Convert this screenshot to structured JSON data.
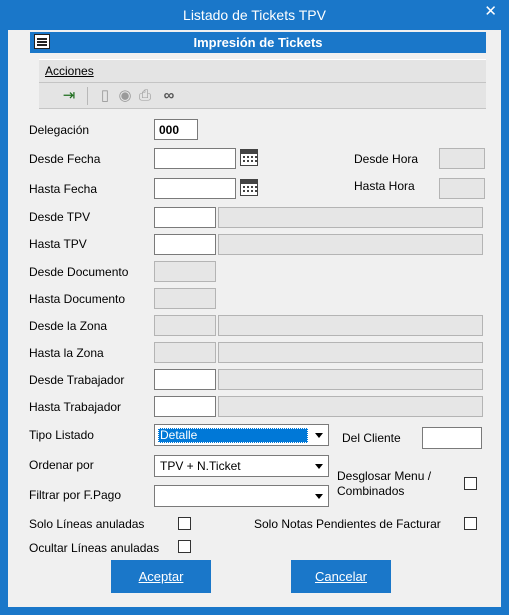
{
  "window": {
    "title": "Listado de Tickets TPV",
    "close_glyph": "✕"
  },
  "header": {
    "title": "Impresión de Tickets",
    "icon": "print-form-icon"
  },
  "menu": {
    "acciones": "Acciones"
  },
  "toolbar": {
    "buttons": [
      {
        "icon": "exit-door-icon",
        "glyph": "⇥"
      },
      {
        "icon": "page-icon",
        "glyph": "▯"
      },
      {
        "icon": "preview-icon",
        "glyph": "◉"
      },
      {
        "icon": "print-icon",
        "glyph": "⎙"
      },
      {
        "icon": "binoculars-icon",
        "glyph": "∞"
      }
    ]
  },
  "form": {
    "delegacion": {
      "label": "Delegación",
      "value": "000"
    },
    "desde_fecha": {
      "label": "Desde Fecha",
      "value": ""
    },
    "hasta_fecha": {
      "label": "Hasta Fecha",
      "value": ""
    },
    "desde_hora": {
      "label": "Desde Hora",
      "value": ""
    },
    "hasta_hora": {
      "label": "Hasta Hora",
      "value": ""
    },
    "desde_tpv": {
      "label": "Desde TPV",
      "value": "",
      "desc": ""
    },
    "hasta_tpv": {
      "label": "Hasta TPV",
      "value": "",
      "desc": ""
    },
    "desde_documento": {
      "label": "Desde Documento",
      "value": ""
    },
    "hasta_documento": {
      "label": "Hasta Documento",
      "value": ""
    },
    "desde_zona": {
      "label": "Desde la Zona",
      "value": "",
      "desc": ""
    },
    "hasta_zona": {
      "label": "Hasta la Zona",
      "value": "",
      "desc": ""
    },
    "desde_trabajador": {
      "label": "Desde Trabajador",
      "value": "",
      "desc": ""
    },
    "hasta_trabajador": {
      "label": "Hasta Trabajador",
      "value": "",
      "desc": ""
    },
    "tipo_listado": {
      "label": "Tipo Listado",
      "selected": "Detalle"
    },
    "del_cliente": {
      "label": "Del Cliente",
      "value": ""
    },
    "ordenar_por": {
      "label": "Ordenar por",
      "selected": "TPV + N.Ticket"
    },
    "filtrar_fpago": {
      "label": "Filtrar por F.Pago",
      "selected": ""
    },
    "desglosar": {
      "label_line1": "Desglosar Menu /",
      "label_line2": "Combinados",
      "checked": false
    },
    "solo_anuladas": {
      "label": "Solo Líneas anuladas",
      "checked": false
    },
    "solo_pendientes": {
      "label": "Solo Notas Pendientes de Facturar",
      "checked": false
    },
    "ocultar_anuladas": {
      "label": "Ocultar Líneas anuladas",
      "checked": false
    }
  },
  "buttons": {
    "aceptar": "Aceptar",
    "cancelar": "Cancelar"
  }
}
